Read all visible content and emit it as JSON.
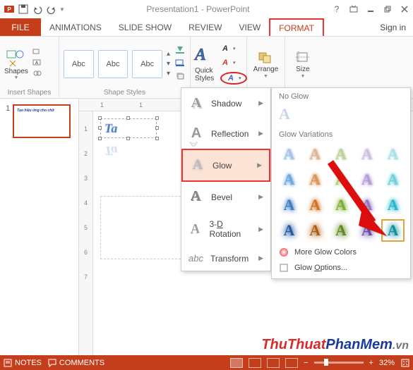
{
  "title": "Presentation1 - PowerPoint",
  "tabs": {
    "file": "FILE",
    "animations": "ANIMATIONS",
    "slideshow": "SLIDE SHOW",
    "review": "REVIEW",
    "view": "VIEW",
    "format": "FORMAT",
    "signin": "Sign in"
  },
  "ribbon": {
    "insert_shapes": "Insert Shapes",
    "shapes": "Shapes",
    "shape_styles": "Shape Styles",
    "abc": "Abc",
    "quick_styles": "Quick Styles",
    "arrange": "Arrange",
    "size": "Size"
  },
  "thumb": {
    "num": "1",
    "text": "Tạo hiệu ứng cho chữ"
  },
  "ruler": {
    "marks": [
      "1",
      "1"
    ],
    "vmarks": [
      "1",
      "2",
      "3",
      "4",
      "5",
      "6",
      "7"
    ]
  },
  "textbox_text": "Ta",
  "fx": {
    "shadow": "Shadow",
    "reflection": "Reflection",
    "glow": "Glow",
    "bevel": "Bevel",
    "rotation_pre": "3-",
    "rotation_key": "D",
    "rotation_post": " Rotation",
    "transform": "Transform"
  },
  "glow": {
    "no_glow": "No Glow",
    "variations": "Glow Variations",
    "more_colors": "More Glow Colors",
    "options_pre": "Glow ",
    "options_key": "O",
    "options_post": "ptions..."
  },
  "status": {
    "notes": "NOTES",
    "comments": "COMMENTS",
    "zoom": "32%"
  },
  "watermark": {
    "p1": "ThuThuat",
    "p2": "PhanMem",
    "p3": ".vn"
  },
  "glow_colors": [
    [
      "#a8c5e8",
      "#dcb89a",
      "#bcd39a",
      "#cfc2e0",
      "#aee0e6"
    ],
    [
      "#6ea6dd",
      "#d7975a",
      "#9ec55f",
      "#b49ed4",
      "#6fd0da"
    ],
    [
      "#3f7ec4",
      "#cf7327",
      "#7fae35",
      "#9576c4",
      "#2ab8c8"
    ],
    [
      "#225a9e",
      "#ad5a13",
      "#5e8821",
      "#6b4aa8",
      "#0e8e9e"
    ]
  ]
}
